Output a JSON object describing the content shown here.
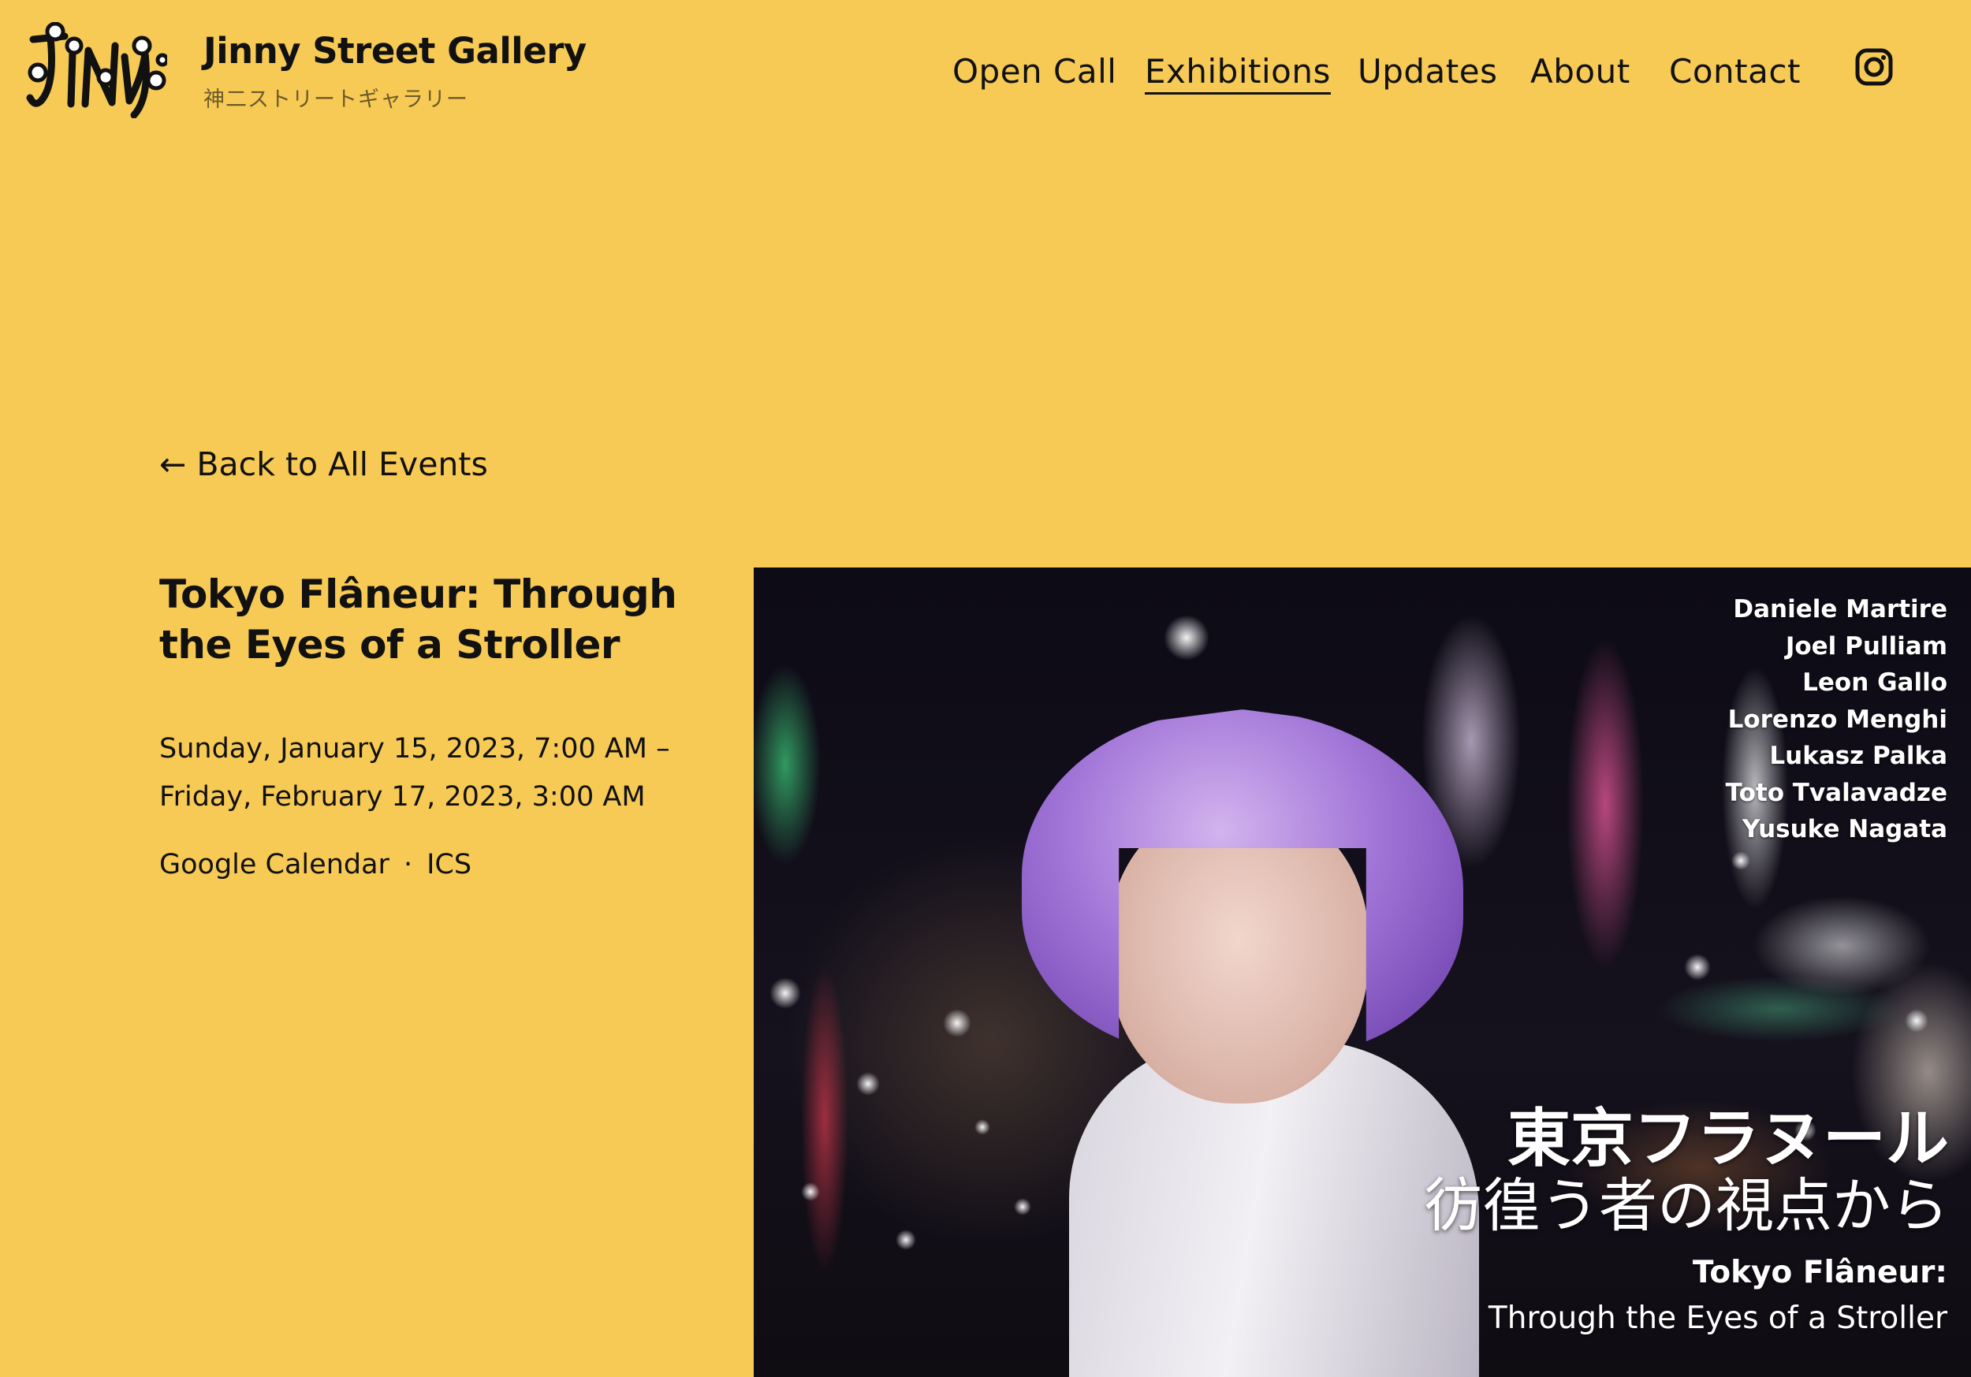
{
  "header": {
    "logo_text": "JINNY",
    "brand_name": "Jinny Street Gallery",
    "brand_sub": "神二ストリートギャラリー",
    "nav": [
      {
        "label": "Open Call",
        "active": false
      },
      {
        "label": "Exhibitions",
        "active": true
      },
      {
        "label": "Updates",
        "active": false
      },
      {
        "label": "About",
        "active": false
      },
      {
        "label": "Contact",
        "active": false
      }
    ],
    "social_icon": "instagram-icon"
  },
  "event": {
    "back_arrow": "←",
    "back_label": "Back to All Events",
    "title": "Tokyo Flâneur: Through the Eyes of a Stroller",
    "date_start": "Sunday, January 15, 2023, 7:00 AM –",
    "date_end": "Friday, February 17, 2023, 3:00 AM",
    "calendar_links": [
      "Google Calendar",
      "ICS"
    ],
    "separator": "·"
  },
  "hero": {
    "artists": [
      "Daniele Martire",
      "Joel Pulliam",
      "Leon Gallo",
      "Lorenzo Menghi",
      "Lukasz Palka",
      "Toto Tvalavadze",
      "Yusuke Nagata"
    ],
    "title_jp_1": "東京フラヌール",
    "title_jp_2": "彷徨う者の視点から",
    "title_en_1": "Tokyo Flâneur:",
    "title_en_2": "Through the Eyes of a Stroller"
  },
  "colors": {
    "background": "#f7ca55",
    "text": "#111111"
  }
}
